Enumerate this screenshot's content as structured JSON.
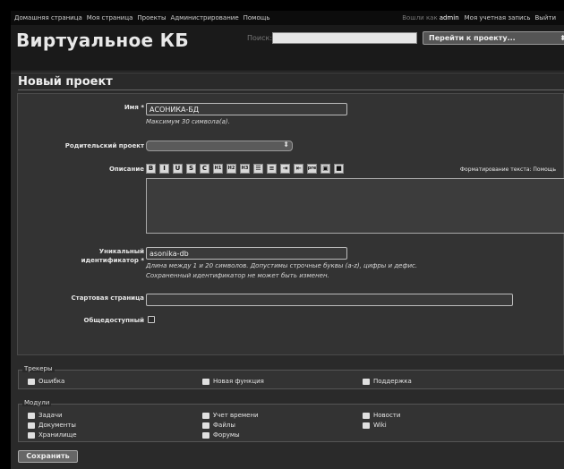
{
  "top_menu": {
    "left": [
      "Домашняя страница",
      "Моя страница",
      "Проекты",
      "Администрирование",
      "Помощь"
    ],
    "logged_in_as": "Вошли как",
    "user": "admin",
    "account": "Моя учетная запись",
    "logout": "Выйти"
  },
  "header": {
    "app_title": "Виртуальное КБ",
    "search_label": "Поиск:",
    "search_value": "",
    "jump_label": "Перейти к проекту..."
  },
  "page": {
    "title": "Новый проект"
  },
  "form": {
    "name": {
      "label": "Имя",
      "required_mark": "*",
      "value": "АСОНИКА-БД",
      "hint": "Максимум 30 символа(а)."
    },
    "parent": {
      "label": "Родительский проект",
      "value": ""
    },
    "description": {
      "label": "Описание",
      "value": "",
      "formatting": "Форматирование текста: Помощь",
      "toolbar": [
        {
          "icon": "bold-icon",
          "glyph": "B"
        },
        {
          "icon": "italic-icon",
          "glyph": "I"
        },
        {
          "icon": "underline-icon",
          "glyph": "U"
        },
        {
          "icon": "strikethrough-icon",
          "glyph": "S"
        },
        {
          "icon": "code-icon",
          "glyph": "C"
        },
        {
          "icon": "heading1-icon",
          "glyph": "H1"
        },
        {
          "icon": "heading2-icon",
          "glyph": "H2"
        },
        {
          "icon": "heading3-icon",
          "glyph": "H3"
        },
        {
          "icon": "unordered-list-icon",
          "glyph": "☰"
        },
        {
          "icon": "ordered-list-icon",
          "glyph": "≡"
        },
        {
          "icon": "indent-icon",
          "glyph": "⇥"
        },
        {
          "icon": "outdent-icon",
          "glyph": "⇤"
        },
        {
          "icon": "preformatted-icon",
          "glyph": "pre"
        },
        {
          "icon": "image-icon",
          "glyph": "▣"
        },
        {
          "icon": "link-icon",
          "glyph": "■"
        }
      ]
    },
    "identifier": {
      "label_line1": "Уникальный",
      "label_line2": "идентификатор",
      "required_mark": "*",
      "value": "asonika-db",
      "hint1": "Длина между 1 и 20 символов. Допустимы строчные буквы (a-z), цифры и дефис.",
      "hint2": "Сохраненный идентификатор не может быть изменен."
    },
    "homepage": {
      "label": "Стартовая страница",
      "value": ""
    },
    "public": {
      "label": "Общедоступный",
      "checked": false
    }
  },
  "trackers": {
    "legend": "Трекеры",
    "items": [
      "Ошибка",
      "Новая функция",
      "Поддержка"
    ]
  },
  "modules": {
    "legend": "Модули",
    "items": [
      "Задачи",
      "Учет времени",
      "Новости",
      "Документы",
      "Файлы",
      "Wiki",
      "Хранилище",
      "Форумы"
    ]
  },
  "actions": {
    "save": "Сохранить"
  }
}
